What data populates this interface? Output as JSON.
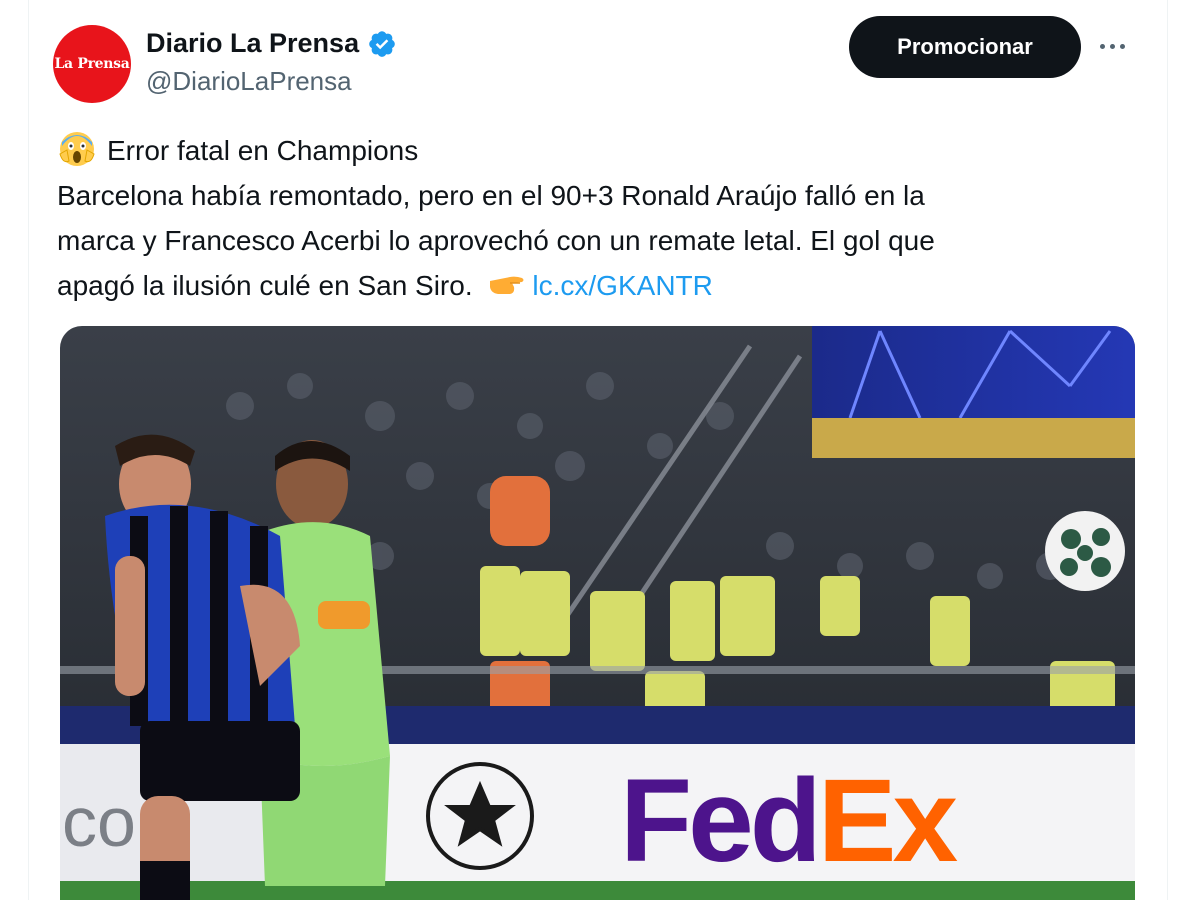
{
  "account": {
    "display_name": "Diario La Prensa",
    "handle": "@DiarioLaPrensa",
    "avatar_text": "La Prensa",
    "verified_icon": "verified-badge-icon",
    "verified_color": "#1d9bf0",
    "avatar_color": "#e8141b"
  },
  "actions": {
    "promote_label": "Promocionar",
    "more_icon": "more-dots-icon"
  },
  "tweet": {
    "headline_emoji": "screaming-face-emoji",
    "headline": "Error fatal en Champions",
    "line1": "Barcelona había remontado, pero en el 90+3 Ronald Araújo falló en la",
    "line2": "marca y Francesco Acerbi lo aprovechó con un remate letal. El gol que",
    "line3": "apagó la ilusión culé en San Siro.",
    "pointing_emoji": "backhand-index-pointing-right-emoji",
    "link_text": "lc.cx/GKANTR",
    "link_color": "#1d9bf0"
  },
  "media": {
    "description_icon": "match-photo",
    "ad_board_text": "FedEx",
    "ad_board_left_text": "co"
  }
}
